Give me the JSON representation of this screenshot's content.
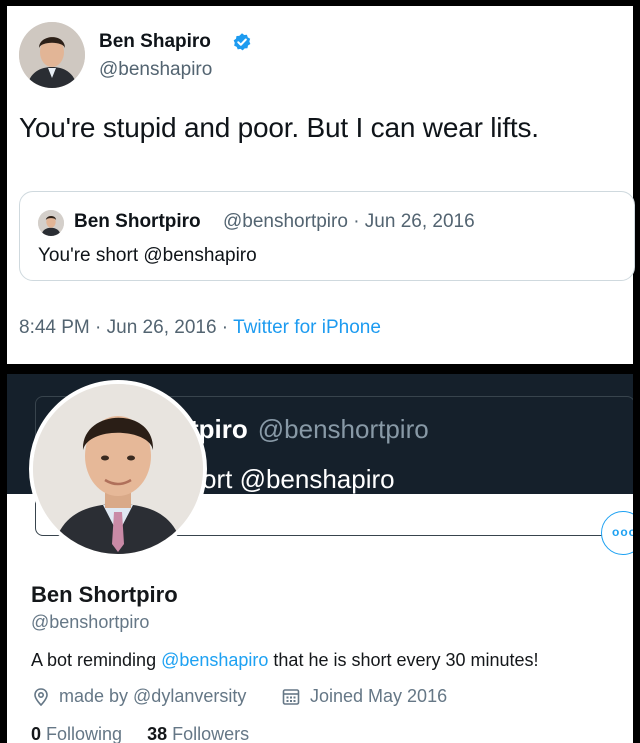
{
  "tweet": {
    "author_name": "Ben Shapiro",
    "author_handle": "@benshapiro",
    "text": "You're stupid and poor. But I can wear lifts.",
    "timestamp": "8:44 PM · Jun 26, 2016 · ",
    "source_app": "Twitter for iPhone",
    "verified_icon": "verified-badge-icon",
    "quoted": {
      "author_name": "Ben Shortpiro",
      "meta": "@benshortpiro · Jun 26, 2016",
      "text": "You're short @benshapiro"
    }
  },
  "profile": {
    "banner_name": "tpiro",
    "banner_handle": "@benshortpiro",
    "banner_text": "ort @benshapiro",
    "more_button_label": "ooo",
    "name": "Ben Shortpiro",
    "handle": "@benshortpiro",
    "bio_before": "A bot reminding ",
    "bio_mention": "@benshapiro",
    "bio_after": " that he is short every 30 minutes!",
    "location": "made by @dylanversity",
    "joined": "Joined May 2016",
    "following_count": "0",
    "following_label": "Following",
    "followers_count": "38",
    "followers_label": "Followers"
  },
  "colors": {
    "link": "#1da1f2",
    "verified": "#1d9bf0",
    "banner": "#15202b"
  }
}
